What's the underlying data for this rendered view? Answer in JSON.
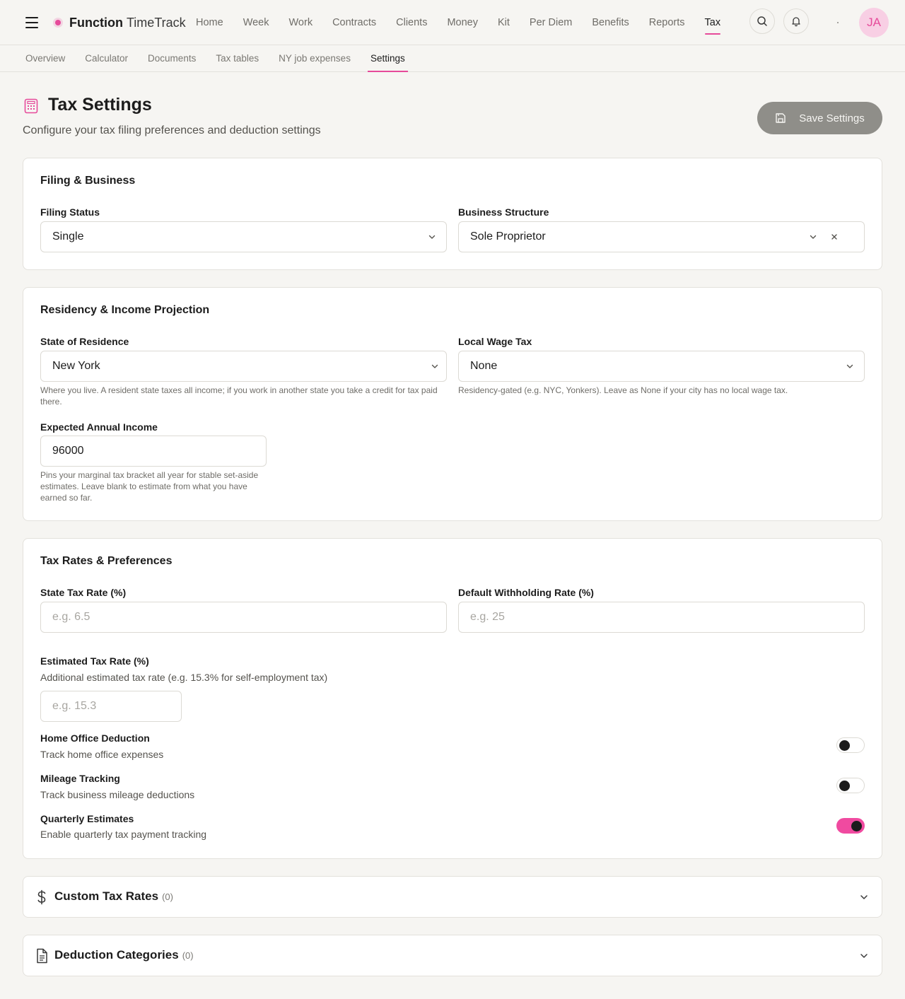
{
  "brand": {
    "strong": "Function",
    "light": "TimeTrack"
  },
  "nav": {
    "items": [
      {
        "label": "Home"
      },
      {
        "label": "Week"
      },
      {
        "label": "Work"
      },
      {
        "label": "Contracts"
      },
      {
        "label": "Clients"
      },
      {
        "label": "Money"
      },
      {
        "label": "Kit"
      },
      {
        "label": "Per Diem"
      },
      {
        "label": "Benefits"
      },
      {
        "label": "Reports"
      },
      {
        "label": "Tax"
      }
    ],
    "active": "Tax",
    "avatar_initials": "JA"
  },
  "subtabs": {
    "items": [
      {
        "label": "Overview"
      },
      {
        "label": "Calculator"
      },
      {
        "label": "Documents"
      },
      {
        "label": "Tax tables"
      },
      {
        "label": "NY job expenses"
      },
      {
        "label": "Settings"
      }
    ],
    "active": "Settings"
  },
  "header": {
    "title": "Tax Settings",
    "subtitle": "Configure your tax filing preferences and deduction settings",
    "save_label": "Save Settings"
  },
  "filing": {
    "title": "Filing & Business",
    "filing_status_label": "Filing Status",
    "filing_status_value": "Single",
    "business_structure_label": "Business Structure",
    "business_structure_value": "Sole Proprietor"
  },
  "residency": {
    "title": "Residency & Income Projection",
    "state_label": "State of Residence",
    "state_value": "New York",
    "state_help": "Where you live. A resident state taxes all income; if you work in another state you take a credit for tax paid there.",
    "local_label": "Local Wage Tax",
    "local_value": "None",
    "local_help": "Residency-gated (e.g. NYC, Yonkers). Leave as None if your city has no local wage tax.",
    "income_label": "Expected Annual Income",
    "income_value": "96000",
    "income_help": "Pins your marginal tax bracket all year for stable set-aside estimates. Leave blank to estimate from what you have earned so far."
  },
  "rates": {
    "title": "Tax Rates & Preferences",
    "state_rate_label": "State Tax Rate (%)",
    "state_rate_placeholder": "e.g. 6.5",
    "withholding_label": "Default Withholding Rate (%)",
    "withholding_placeholder": "e.g. 25",
    "estimated_label": "Estimated Tax Rate (%)",
    "estimated_desc": "Additional estimated tax rate (e.g. 15.3% for self-employment tax)",
    "estimated_placeholder": "e.g. 15.3",
    "toggles": [
      {
        "label": "Home Office Deduction",
        "desc": "Track home office expenses",
        "on": false
      },
      {
        "label": "Mileage Tracking",
        "desc": "Track business mileage deductions",
        "on": false
      },
      {
        "label": "Quarterly Estimates",
        "desc": "Enable quarterly tax payment tracking",
        "on": true
      }
    ]
  },
  "accordions": [
    {
      "title": "Custom Tax Rates",
      "count": "(0)",
      "icon": "dollar-icon"
    },
    {
      "title": "Deduction Categories",
      "count": "(0)",
      "icon": "document-icon"
    }
  ],
  "colors": {
    "accent": "#e64a9a",
    "toggle_on": "#f04aa0",
    "save_button": "#8f8e89"
  }
}
